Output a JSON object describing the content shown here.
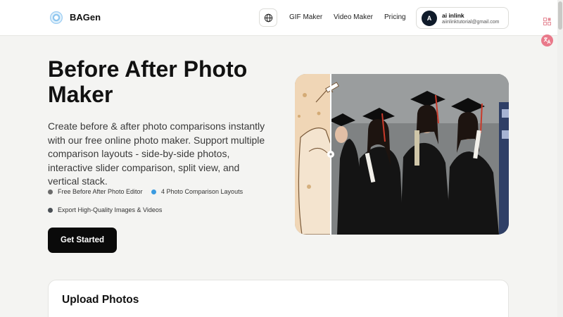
{
  "header": {
    "brand": "BAGen",
    "nav": {
      "gif_maker": "GIF Maker",
      "video_maker": "Video Maker",
      "pricing": "Pricing"
    },
    "account": {
      "avatar_initial": "A",
      "name": "ai inlink",
      "email": "aiinlinktutorial@gmail.com"
    },
    "icons": [
      "logo-icon",
      "globe-icon"
    ]
  },
  "hero": {
    "title": "Before After Photo Maker",
    "description": "Create before & after photo comparisons instantly with our free online photo maker. Support multiple comparison layouts - side-by-side photos, interactive slider comparison, split view, and vertical stack.",
    "features": [
      {
        "label": "Free Before After Photo Editor",
        "color": "#6b6b6b"
      },
      {
        "label": "4 Photo Comparison Layouts",
        "color": "#3b9be0"
      },
      {
        "label": "Export High-Quality Images & Videos",
        "color": "#4a4f55"
      }
    ],
    "cta": "Get Started"
  },
  "upload": {
    "title": "Upload Photos"
  },
  "colors": {
    "accent": "#0a0a0a",
    "background": "#f4f4f2",
    "side_icon_pink": "#e9798a"
  }
}
